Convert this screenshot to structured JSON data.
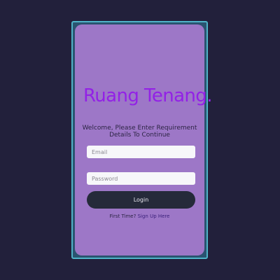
{
  "brand": {
    "title": "Ruang Tenang."
  },
  "intro": {
    "text": "Welcome, Please Enter Requirement Details To Continue"
  },
  "form": {
    "email_placeholder": "Email",
    "password_placeholder": "Password",
    "login_label": "Login"
  },
  "footer": {
    "prompt": "First Time?",
    "signup_link": "Sign Up Here"
  },
  "colors": {
    "background": "#22203b",
    "card": "#9d77c7",
    "brand": "#9321e6",
    "button": "#252a3a",
    "frame_border": "#4fb3c8"
  }
}
